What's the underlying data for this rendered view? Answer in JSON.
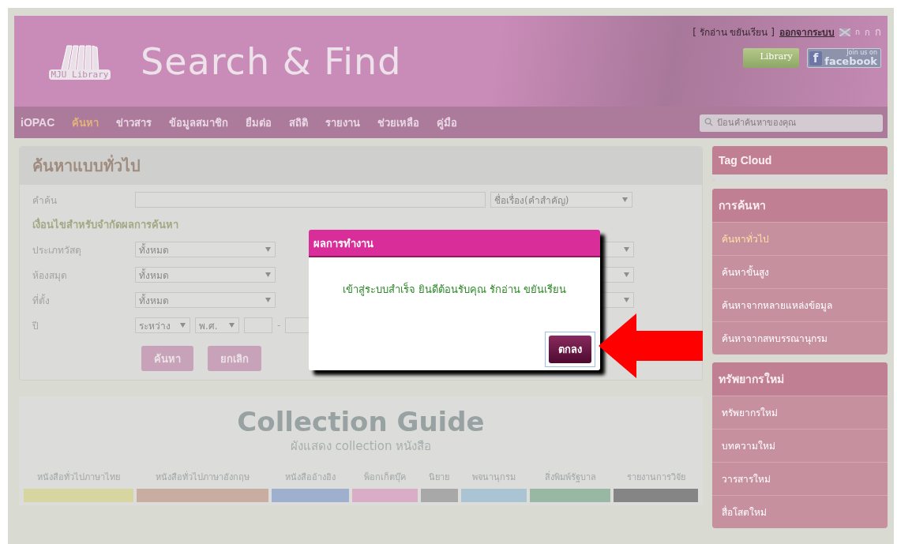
{
  "header": {
    "logo_text": "MJU Library",
    "title": "Search & Find",
    "user": "[ รักอ่าน ขยันเรียน ]",
    "logout": "ออกจากระบบ",
    "font_sizes": [
      "ก",
      "ก",
      "ก"
    ],
    "library_badge": "Library",
    "facebook_badge": {
      "icon": "f",
      "small": "Join us on",
      "big": "facebook"
    }
  },
  "nav": {
    "items": [
      {
        "label": "iOPAC",
        "selected": false
      },
      {
        "label": "ค้นหา",
        "selected": true
      },
      {
        "label": "ข่าวสาร",
        "selected": false
      },
      {
        "label": "ข้อมูลสมาชิก",
        "selected": false
      },
      {
        "label": "ยืมต่อ",
        "selected": false
      },
      {
        "label": "สถิติ",
        "selected": false
      },
      {
        "label": "รายงาน",
        "selected": false
      },
      {
        "label": "ช่วยเหลือ",
        "selected": false
      },
      {
        "label": "คู่มือ",
        "selected": false
      }
    ],
    "search": {
      "placeholder": "ป้อนคำค้นหาของคุณ"
    }
  },
  "search_panel": {
    "title": "ค้นหาแบบทั่วไป",
    "keyword_label": "คำค้น",
    "field_select": "ชื่อเรื่อง(คำสำคัญ)",
    "limits_heading": "เงื่อนไขสำหรับจำกัดผลการค้นหา",
    "filters": [
      {
        "label": "ประเภทวัสดุ",
        "value": "ทั้งหมด"
      },
      {
        "label": "ห้องสมุด",
        "value": "ทั้งหมด"
      },
      {
        "label": "ที่ตั้ง",
        "value": "ทั้งหมด"
      }
    ],
    "year": {
      "label": "ปี",
      "range": "ระหว่าง",
      "era": "พ.ศ.",
      "separator": "-"
    },
    "buttons": [
      "ค้นหา",
      "ยกเลิก"
    ]
  },
  "sidebar": {
    "tag_cloud": "Tag Cloud",
    "sections": [
      {
        "title": "การค้นหา",
        "items": [
          {
            "label": "ค้นหาทั่วไป",
            "selected": true
          },
          {
            "label": "ค้นหาขั้นสูง",
            "selected": false
          },
          {
            "label": "ค้นหาจากหลายแหล่งข้อมูล",
            "selected": false
          },
          {
            "label": "ค้นหาจากสหบรรณานุกรม",
            "selected": false
          }
        ]
      },
      {
        "title": "ทรัพยากรใหม่",
        "items": [
          {
            "label": "ทรัพยากรใหม่",
            "selected": false
          },
          {
            "label": "บทความใหม่",
            "selected": false
          },
          {
            "label": "วารสารใหม่",
            "selected": false
          },
          {
            "label": "สื่อโสตใหม่",
            "selected": false
          }
        ]
      }
    ]
  },
  "collection_guide": {
    "title": "Collection Guide",
    "subtitle": "ผังแสดง collection หนังสือ",
    "categories": [
      {
        "label": "หนังสือทั่วไปภาษาไทย",
        "color": "#d8d6a0"
      },
      {
        "label": "หนังสือทั่วไปภาษาอังกฤษ",
        "color": "#c8ada0"
      },
      {
        "label": "หนังสืออ้างอิง",
        "color": "#9fb0ce"
      },
      {
        "label": "พ็อกเก็ตบุ๊ค",
        "color": "#d9adc6"
      },
      {
        "label": "นิยาย",
        "color": "#a8a8a8"
      },
      {
        "label": "พจนานุกรม",
        "color": "#aac4d4"
      },
      {
        "label": "สิ่งพิมพ์รัฐบาล",
        "color": "#99b8a4"
      },
      {
        "label": "รายงานการวิจัย",
        "color": "#858585"
      }
    ]
  },
  "dialog": {
    "title": "ผลการทำงาน",
    "message": "เข้าสู่ระบบสำเร็จ ยินดีต้อนรับคุณ รักอ่าน ขยันเรียน",
    "button": "ตกลง"
  }
}
